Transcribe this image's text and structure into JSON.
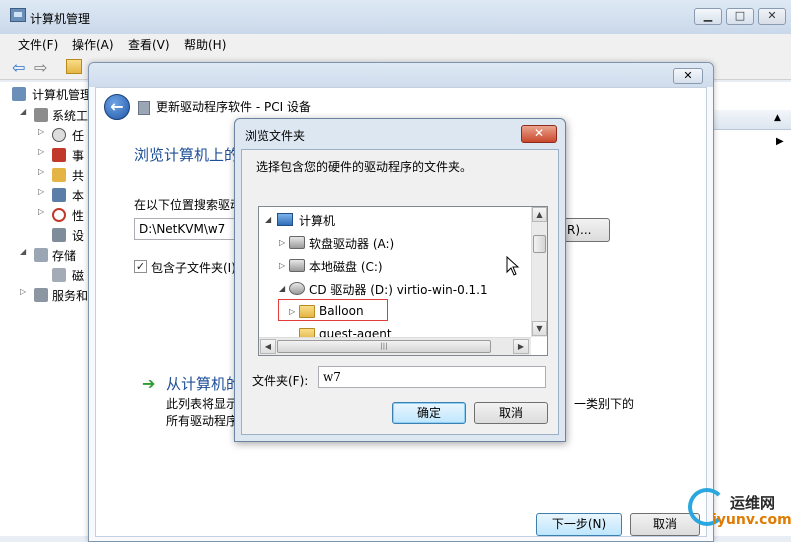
{
  "mmc": {
    "title": "计算机管理",
    "controls": {
      "minimize": "▁",
      "maximize": "□",
      "close": "✕"
    },
    "menu": [
      "文件(F)",
      "操作(A)",
      "查看(V)",
      "帮助(H)"
    ],
    "tree": [
      {
        "label": "计算机管理",
        "expander": ""
      },
      {
        "label": "系统工",
        "expander": "◢"
      },
      {
        "label": "任",
        "expander": "▷"
      },
      {
        "label": "事",
        "expander": "▷"
      },
      {
        "label": "共",
        "expander": "▷"
      },
      {
        "label": "本",
        "expander": "▷"
      },
      {
        "label": "性",
        "expander": "▷"
      },
      {
        "label": "设",
        "expander": ""
      },
      {
        "label": "存储",
        "expander": "◢"
      },
      {
        "label": "磁",
        "expander": ""
      },
      {
        "label": "服务和",
        "expander": "▷"
      }
    ],
    "actions_arrow_up": "▲",
    "actions_arrow_right": "▶"
  },
  "wizard": {
    "header": "更新驱动程序软件 - PCI 设备",
    "close": "✕",
    "back": "←",
    "heading": "浏览计算机上的驱动程序文件",
    "search_label": "在以下位置搜索驱动程序软件:",
    "path_value": "D:\\NetKVM\\w7",
    "browse_button": "R)...",
    "include_subfolders_label": "包含子文件夹(I)",
    "include_subfolders_checked": "✓",
    "link_arrow": "➔",
    "link_heading": "从计算机的设备驱动程序列表中选择",
    "link_desc_1": "此列表将显示与该设备兼容的已安装的驱动程序软件",
    "link_desc_2": "所有驱动程序软件。",
    "link_tail": "一类别下的",
    "next_button": "下一步(N)",
    "cancel_button": "取消"
  },
  "browse": {
    "title": "浏览文件夹",
    "close": "✕",
    "instruction": "选择包含您的硬件的驱动程序的文件夹。",
    "tree": [
      {
        "label": "计算机",
        "expander": "◢",
        "icon": "computer-icon",
        "indent": 0
      },
      {
        "label": "软盘驱动器 (A:)",
        "expander": "▷",
        "icon": "floppy-drive-icon",
        "indent": 1
      },
      {
        "label": "本地磁盘 (C:)",
        "expander": "▷",
        "icon": "local-disk-icon",
        "indent": 1
      },
      {
        "label": "CD 驱动器 (D:) virtio-win-0.1.1",
        "expander": "◢",
        "icon": "cd-drive-icon",
        "indent": 1
      },
      {
        "label": "Balloon",
        "expander": "▷",
        "icon": "folder-icon",
        "indent": 2
      },
      {
        "label": "guest-agent",
        "expander": "",
        "icon": "folder-icon",
        "indent": 2
      }
    ],
    "scroll_up": "▲",
    "scroll_down": "▼",
    "scroll_left": "◀",
    "scroll_right": "▶",
    "thumb_grip": "|||",
    "folder_label": "文件夹(F):",
    "folder_value": "w7",
    "ok_button": "确定",
    "cancel_button": "取消"
  },
  "watermark": {
    "name": "运维网",
    "url": "iyunv.com"
  }
}
